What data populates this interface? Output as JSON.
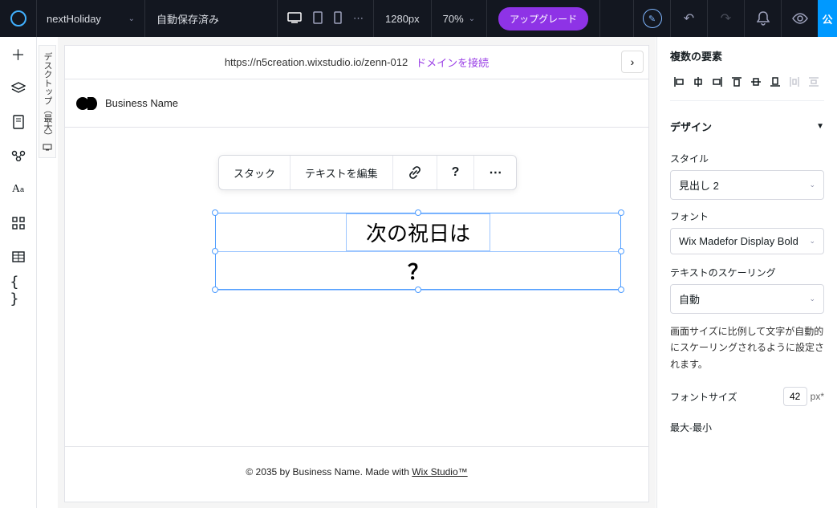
{
  "topbar": {
    "site_name": "nextHoliday",
    "saved_label": "自動保存済み",
    "canvas_px": "1280px",
    "zoom": "70%",
    "upgrade_label": "アップグレード",
    "dots": "⋯",
    "publish_label": "公"
  },
  "breakpoint": {
    "label": "デスクトップ（最大）"
  },
  "url_bar": {
    "url": "https://n5creation.wixstudio.io/zenn-012",
    "connect_label": "ドメインを接続"
  },
  "site_header": {
    "business_name": "Business Name"
  },
  "float_toolbar": {
    "stack": "スタック",
    "edit_text": "テキストを編集",
    "link_icon": "🔗",
    "help_icon": "?",
    "more_icon": "⋯"
  },
  "selection": {
    "line1": "次の祝日は",
    "line2": "？"
  },
  "footer": {
    "prefix": "© 2035 by Business Name. Made with ",
    "link": "Wix Studio™"
  },
  "right_panel": {
    "title": "複数の要素",
    "design_section": "デザイン",
    "style_label": "スタイル",
    "style_value": "見出し 2",
    "font_label": "フォント",
    "font_value": "Wix Madefor Display Bold",
    "scaling_label": "テキストのスケーリング",
    "scaling_value": "自動",
    "scaling_help": "画面サイズに比例して文字が自動的にスケーリングされるように設定されます。",
    "font_size_label": "フォントサイズ",
    "font_size_value": "42",
    "font_size_unit": "px*",
    "minmax_label": "最大-最小"
  }
}
